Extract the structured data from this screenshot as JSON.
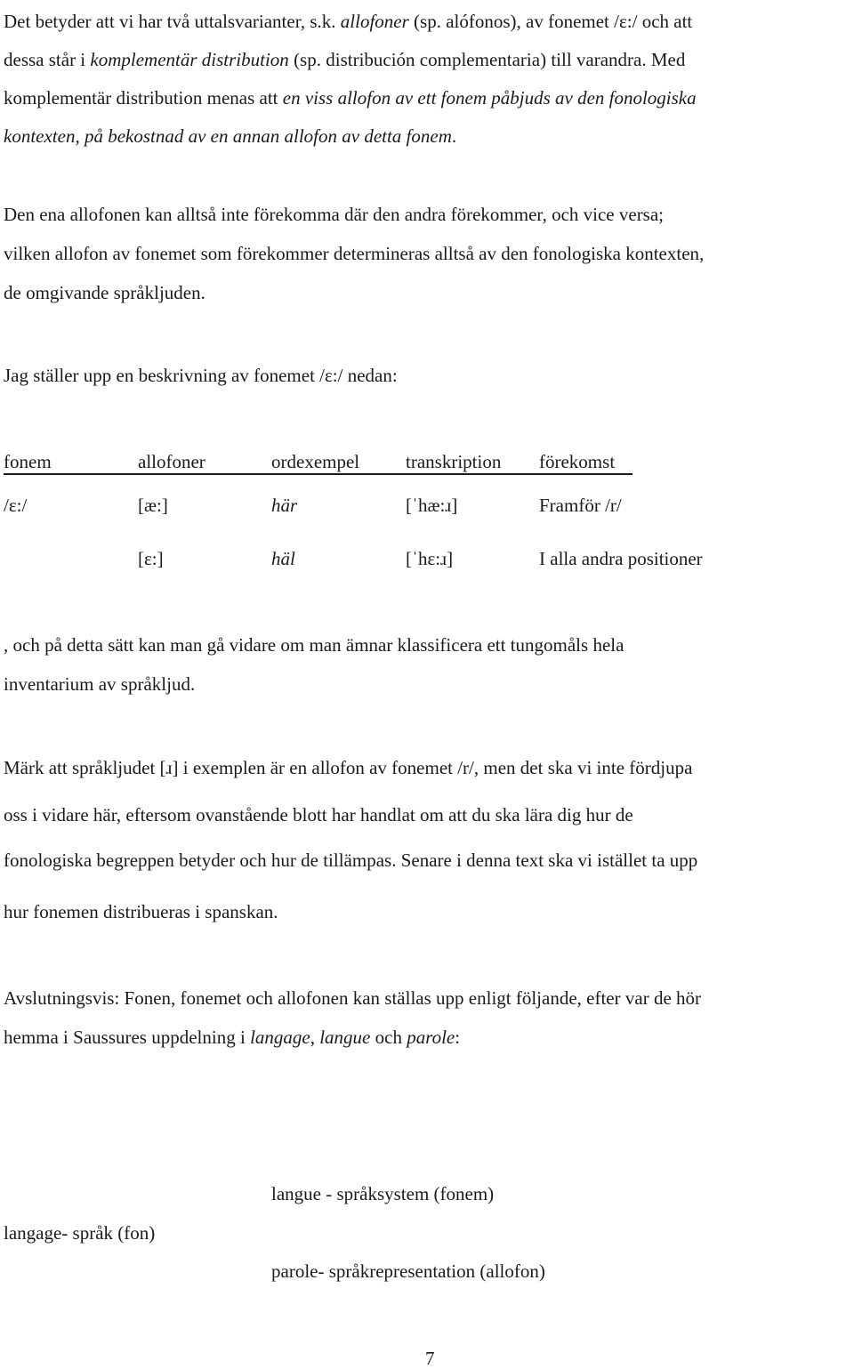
{
  "paragraph1": {
    "line1": {
      "a": "Det betyder att vi har två uttalsvarianter, s.k. ",
      "b": "allofoner",
      "c": " (sp. alófonos), av fonemet /ɛ:/ och att"
    },
    "line2": {
      "a": "dessa står i ",
      "b": "komplementär distribution",
      "c": " (sp. distribución complementaria) till varandra. Med"
    },
    "line3": {
      "a": "komplementär distribution menas att ",
      "b": "en viss allofon av ett fonem påbjuds av den fonologiska"
    },
    "line4": {
      "b": "kontexten, på bekostnad av en annan allofon av detta fonem",
      "c": "."
    }
  },
  "paragraph2": {
    "lines": [
      "Den ena allofonen kan alltså inte förekomma där den andra förekommer, och vice versa;",
      "vilken allofon av fonemet som förekommer determineras alltså av den fonologiska kontexten,",
      "de omgivande språkljuden."
    ]
  },
  "paragraph3": {
    "text": "Jag ställer upp en beskrivning av fonemet /ɛ:/ nedan:"
  },
  "table": {
    "headers": [
      "fonem",
      "allofoner",
      "ordexempel",
      "transkription",
      "förekomst"
    ],
    "rows": [
      {
        "fonem": "/ɛ:/",
        "allofon": "[æ:]",
        "ordexempel": "här",
        "transkription": "[ˈhæ:ɹ]",
        "forekomst": "Framför /r/"
      },
      {
        "fonem": "",
        "allofon": "[ɛ:]",
        "ordexempel": "häl",
        "transkription": "[ˈhɛ:ɹ]",
        "forekomst": "I alla andra positioner"
      }
    ]
  },
  "paragraph4": {
    "lines": [
      ", och på detta sätt kan man gå vidare om man ämnar klassificera ett tungomåls hela",
      "inventarium av språkljud."
    ]
  },
  "paragraph5": {
    "lines": [
      "Märk att språkljudet [ɹ] i exemplen är en allofon av fonemet /r/,  men det ska vi inte fördjupa",
      "oss i vidare här, eftersom ovanstående blott har handlat om att du ska lära dig hur de",
      "fonologiska begreppen betyder och hur de tillämpas. Senare i denna text ska vi istället ta upp",
      "hur fonemen distribueras i spanskan."
    ]
  },
  "paragraph6": {
    "line1": "Avslutningsvis: Fonen, fonemet och allofonen kan ställas upp enligt följande, efter var de hör",
    "line2": {
      "a": "hemma i Saussures uppdelning i ",
      "b": "langage",
      "c": ", ",
      "d": "langue",
      "e": " och ",
      "f": "parole",
      "g": ":"
    }
  },
  "diagram": {
    "langue": "langue - språksystem (fonem)",
    "langage": "langage- språk (fon)",
    "parole": "parole- språkrepresentation (allofon)"
  },
  "page_number": "7"
}
